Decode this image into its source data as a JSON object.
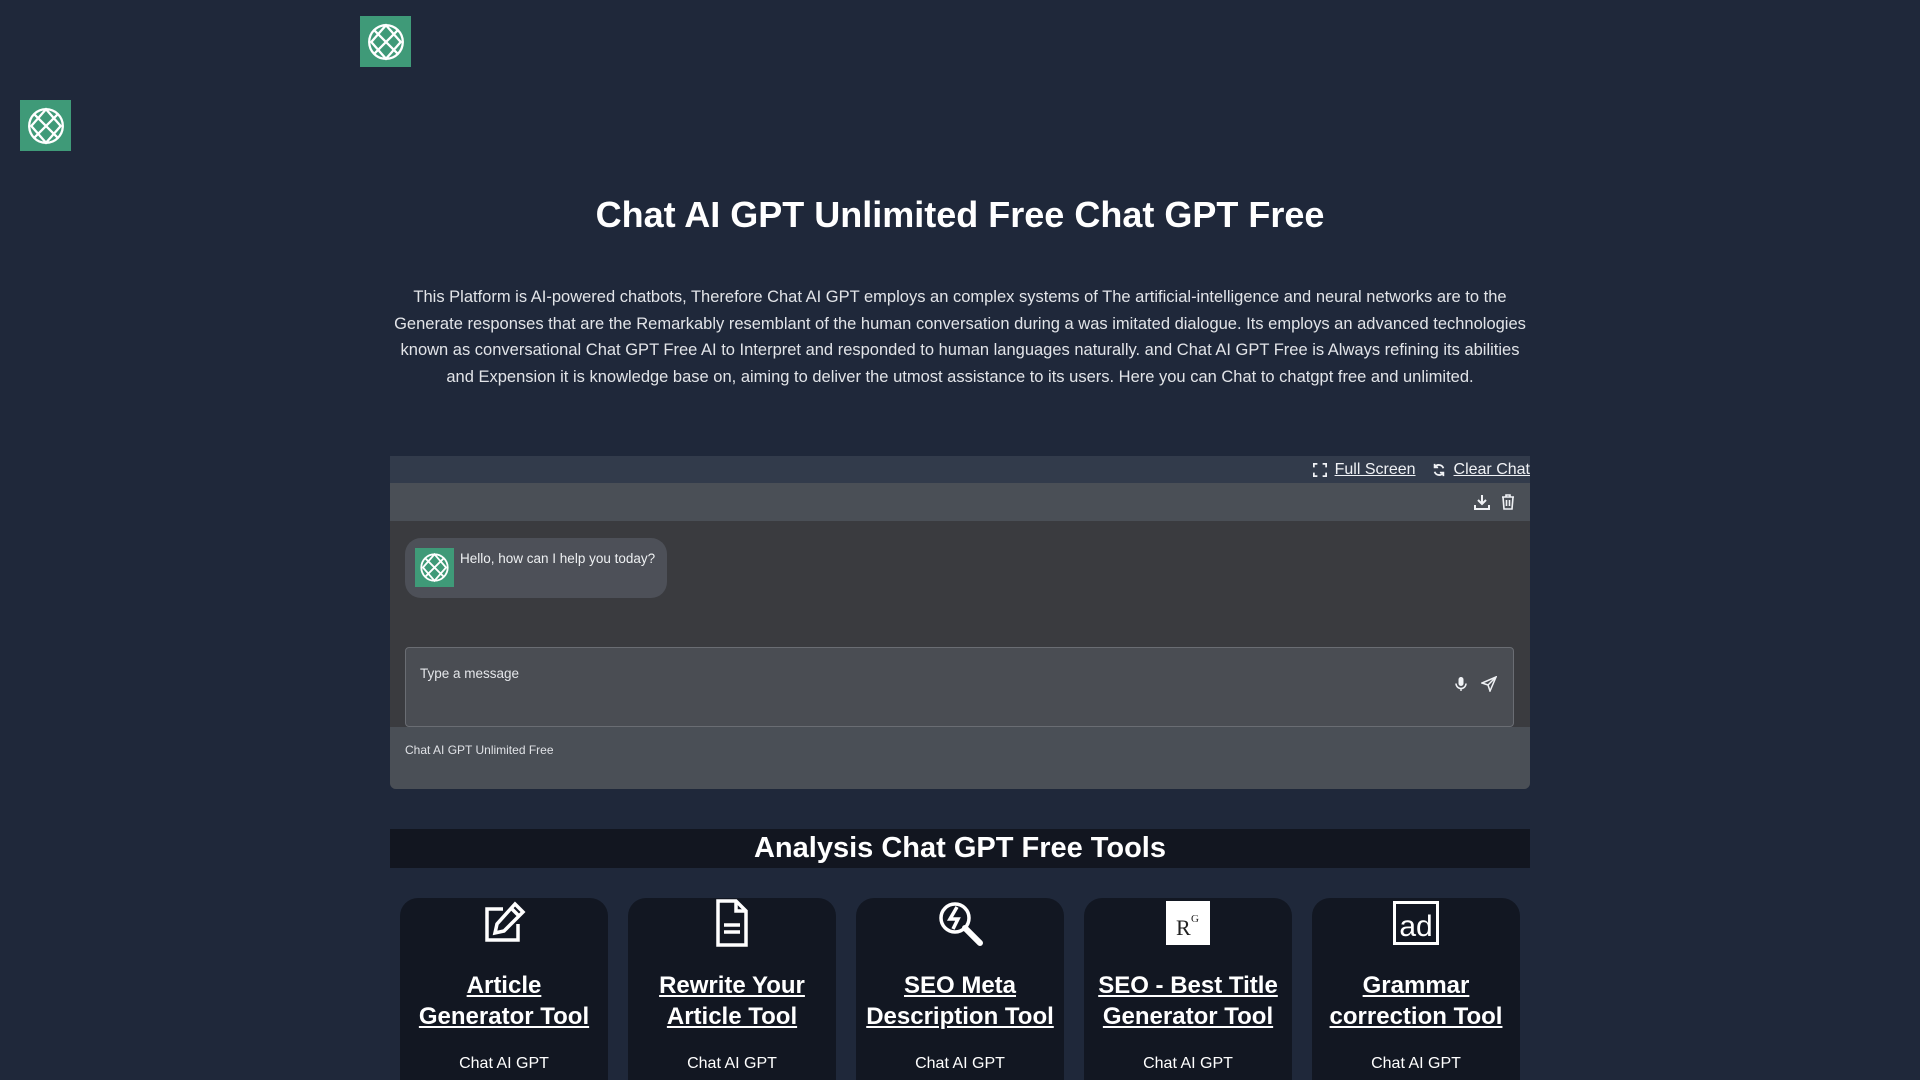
{
  "page": {
    "title": "Chat AI GPT Unlimited Free Chat GPT Free",
    "intro": "This Platform is AI-powered chatbots, Therefore Chat AI GPT employs an complex systems of The artificial-intelligence and neural networks are to the Generate responses that are the Remarkably resemblant of the human conversation during a was imitated dialogue. Its employs an advanced technologies known as conversational Chat GPT Free AI to Interpret and responded to human languages naturally. and Chat AI GPT Free is Always refining its abilities and Expension it is knowledge base on, aiming to deliver the utmost assistance to its users. Here you can Chat to chatgpt free and unlimited."
  },
  "chat": {
    "fullscreen_label": "Full Screen",
    "clear_label": "Clear Chat",
    "greeting": "Hello, how can I help you today?",
    "input_placeholder": "Type a message",
    "footer": "Chat AI GPT Unlimited Free"
  },
  "tools": {
    "heading": "Analysis Chat GPT Free Tools",
    "items": [
      {
        "icon": "edit-icon",
        "title": "Article Generator Tool",
        "subtitle": "Chat AI GPT"
      },
      {
        "icon": "document-icon",
        "title": "Rewrite Your Article Tool",
        "subtitle": "Chat AI GPT"
      },
      {
        "icon": "search-bolt-icon",
        "title": "SEO Meta Description Tool",
        "subtitle": "Chat AI GPT"
      },
      {
        "icon": "research-gate-icon",
        "title": "SEO - Best Title Generator Tool",
        "subtitle": "Chat AI GPT"
      },
      {
        "icon": "ad-icon",
        "title": "Grammar correction Tool",
        "subtitle": "Chat AI GPT"
      }
    ]
  },
  "colors": {
    "background": "#1f283a",
    "logo_green": "#3f9a78",
    "card_bg": "#121722"
  }
}
